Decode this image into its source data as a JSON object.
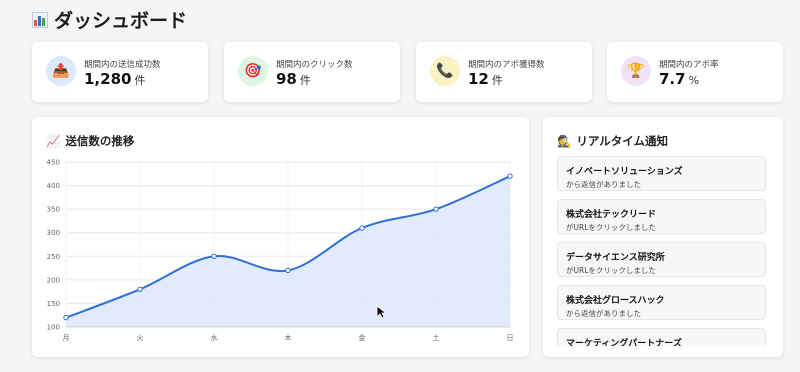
{
  "page": {
    "title": "ダッシュボード",
    "title_icon": "bar-chart-icon"
  },
  "stats": [
    {
      "label": "期間内の送信成功数",
      "value": "1,280",
      "unit": "件",
      "icon": "outbox-tray-icon",
      "icon_bg": "#dce8fb",
      "icon_glyph": "📤"
    },
    {
      "label": "期間内のクリック数",
      "value": "98",
      "unit": "件",
      "icon": "target-icon",
      "icon_bg": "#dcf5e4",
      "icon_glyph": "🎯"
    },
    {
      "label": "期間内のアポ獲得数",
      "value": "12",
      "unit": "件",
      "icon": "telephone-icon",
      "icon_bg": "#fbf2c4",
      "icon_glyph": "📞"
    },
    {
      "label": "期間内のアポ率",
      "value": "7.7",
      "unit": "%",
      "icon": "trophy-icon",
      "icon_bg": "#efe2f8",
      "icon_glyph": "🏆"
    }
  ],
  "chart_section": {
    "title": "送信数の推移",
    "icon": "line-chart-icon",
    "icon_glyph": "📈"
  },
  "chart_data": {
    "type": "area",
    "categories": [
      "月",
      "火",
      "水",
      "木",
      "金",
      "土",
      "日"
    ],
    "values": [
      120,
      180,
      250,
      220,
      310,
      350,
      420
    ],
    "y_ticks": [
      100,
      150,
      200,
      250,
      300,
      350,
      400,
      450
    ],
    "ylim": [
      100,
      450
    ],
    "grid": true,
    "line_color": "#2f6fd6",
    "fill_color": "#dde8fb"
  },
  "notifications": {
    "title": "リアルタイム通知",
    "icon": "detective-icon",
    "icon_glyph": "🕵",
    "items": [
      {
        "company": "イノベートソリューションズ",
        "message": "から返信がありました"
      },
      {
        "company": "株式会社テックリード",
        "message": "がURLをクリックしました"
      },
      {
        "company": "データサイエンス研究所",
        "message": "がURLをクリックしました"
      },
      {
        "company": "株式会社グロースハック",
        "message": "から返信がありました"
      },
      {
        "company": "マーケティングパートナーズ",
        "message": ""
      }
    ]
  },
  "colors": {
    "background": "#f4f5f7",
    "card": "#ffffff",
    "accent": "#2f6fd6"
  }
}
